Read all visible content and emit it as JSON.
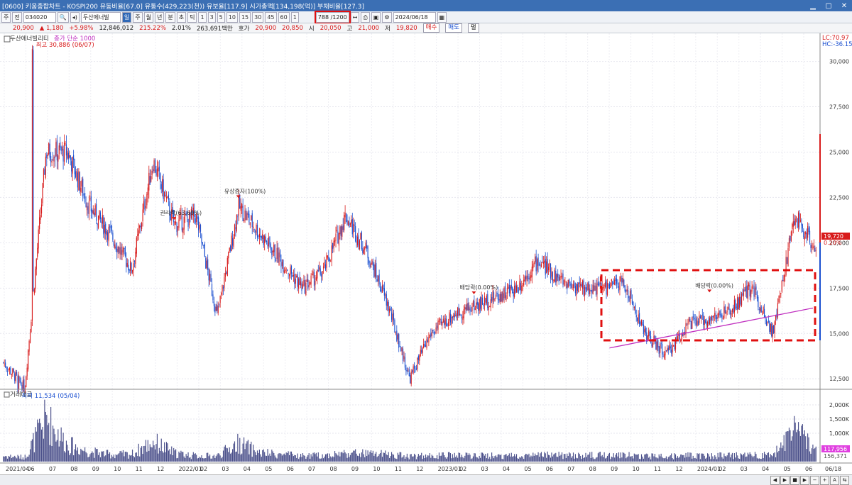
{
  "window": {
    "title": "[0600] 키움종합차트 - KOSPI200 유동비율[67.0] 유통수(429,223(천)) 유보율[117.9] 시가총액[134,198(억)] 부채비율[127.3]"
  },
  "toolbar": {
    "mode": "주",
    "scope": "전",
    "code": "034020",
    "name": "두산에너빌",
    "periods": [
      "주",
      "월",
      "년",
      "분",
      "초",
      "틱"
    ],
    "minutes": [
      "1",
      "3",
      "5",
      "10",
      "15",
      "30",
      "45",
      "60"
    ],
    "one": "1",
    "counter": "788 /1200",
    "date": "2024/06/18"
  },
  "quote": {
    "price": "20,900",
    "change": "▲ 1,180",
    "pct": "+5.98%",
    "volume": "12,846,012",
    "vol_pct": "215.22%",
    "turnover": "2.01%",
    "amount": "263,691백만",
    "hoga_label": "호가",
    "bid1": "20,900",
    "ask1": "20,850",
    "open_label": "시",
    "open": "20,050",
    "high_label": "고",
    "high": "21,000",
    "low_label": "저",
    "low": "19,820",
    "buy": "매수",
    "sell": "매도",
    "extra": "펼"
  },
  "chart": {
    "legend_name": "두산에너빌리티",
    "legend_sub": "종가 단순 1000",
    "lc": "LC:70.97",
    "hc": "HC:-36.15",
    "high_mark": "최고 30,886 (06/07)",
    "low_mark": "최저 11,534 (05/04)",
    "price_ticks": [
      "30,000",
      "27,500",
      "25,000",
      "22,500",
      "20,000",
      "17,500",
      "15,000",
      "12,500"
    ],
    "price_tag": "19,720",
    "price_tag_pct": "0.20%",
    "volume_title": "거래대금",
    "volume_ticks": [
      "2,000K",
      "1,500K",
      "1,000K",
      "500,000"
    ],
    "volume_tag": "117,956",
    "volume_tag2": "156,371",
    "annotations": [
      "유상증자(100%)",
      "권리락(63.69%)",
      "배당락(0.00%)",
      "배당락(0.00%)"
    ],
    "date_labels": [
      "2021/04",
      "06",
      "07",
      "08",
      "09",
      "10",
      "11",
      "12",
      "2022/01",
      "02",
      "03",
      "04",
      "05",
      "06",
      "07",
      "08",
      "09",
      "10",
      "11",
      "12",
      "2023/01",
      "02",
      "03",
      "04",
      "05",
      "06",
      "07",
      "08",
      "09",
      "10",
      "11",
      "12",
      "2024/01",
      "02",
      "03",
      "04",
      "05",
      "06",
      "06/18"
    ],
    "colors": {
      "up": "#d81b1b",
      "down": "#1a4fd0",
      "trend": "#c030c0",
      "box": "#e01010",
      "volume": "#4a4f8a"
    }
  },
  "chart_data": {
    "type": "candlestick",
    "title": "두산에너빌리티",
    "x": [
      "2021/04",
      "2021/05",
      "2021/06",
      "2021/07",
      "2021/08",
      "2021/09",
      "2021/10",
      "2021/11",
      "2021/12",
      "2022/01",
      "2022/02",
      "2022/03",
      "2022/04",
      "2022/05",
      "2022/06",
      "2022/07",
      "2022/08",
      "2022/09",
      "2022/10",
      "2022/11",
      "2022/12",
      "2023/01",
      "2023/02",
      "2023/03",
      "2023/04",
      "2023/05",
      "2023/06",
      "2023/07",
      "2023/08",
      "2023/09",
      "2023/10",
      "2023/11",
      "2023/12",
      "2024/01",
      "2024/02",
      "2024/03",
      "2024/04",
      "2024/05",
      "2024/06"
    ],
    "series": [
      {
        "name": "종가",
        "values": [
          13400,
          12000,
          25000,
          25000,
          22000,
          20500,
          18500,
          24500,
          21000,
          21500,
          16000,
          22000,
          20500,
          19000,
          17500,
          18500,
          21500,
          19500,
          16500,
          12500,
          15000,
          16000,
          16500,
          17000,
          17500,
          19000,
          18000,
          17500,
          17500,
          17800,
          15000,
          13800,
          15500,
          15800,
          16200,
          17600,
          15000,
          21500,
          19720
        ]
      },
      {
        "name": "거래대금",
        "values": [
          200,
          150,
          1500,
          600,
          350,
          250,
          260,
          700,
          300,
          200,
          200,
          650,
          300,
          250,
          200,
          220,
          300,
          280,
          250,
          200,
          200,
          220,
          200,
          210,
          210,
          230,
          220,
          210,
          220,
          230,
          200,
          180,
          220,
          200,
          210,
          250,
          230,
          1100,
          400
        ]
      }
    ],
    "price_ylim": [
      12000,
      31000
    ],
    "price_axis_ticks": [
      12500,
      15000,
      17500,
      20000,
      22500,
      25000,
      27500,
      30000
    ],
    "volume_ylim": [
      0,
      2300
    ],
    "volume_unit": "K",
    "high": {
      "value": 30886,
      "date": "06/07"
    },
    "low": {
      "value": 11534,
      "date": "05/04"
    },
    "last": 19720,
    "trendline": {
      "from": [
        "2023/08",
        14200
      ],
      "to": [
        "2024/06",
        16400
      ]
    }
  }
}
